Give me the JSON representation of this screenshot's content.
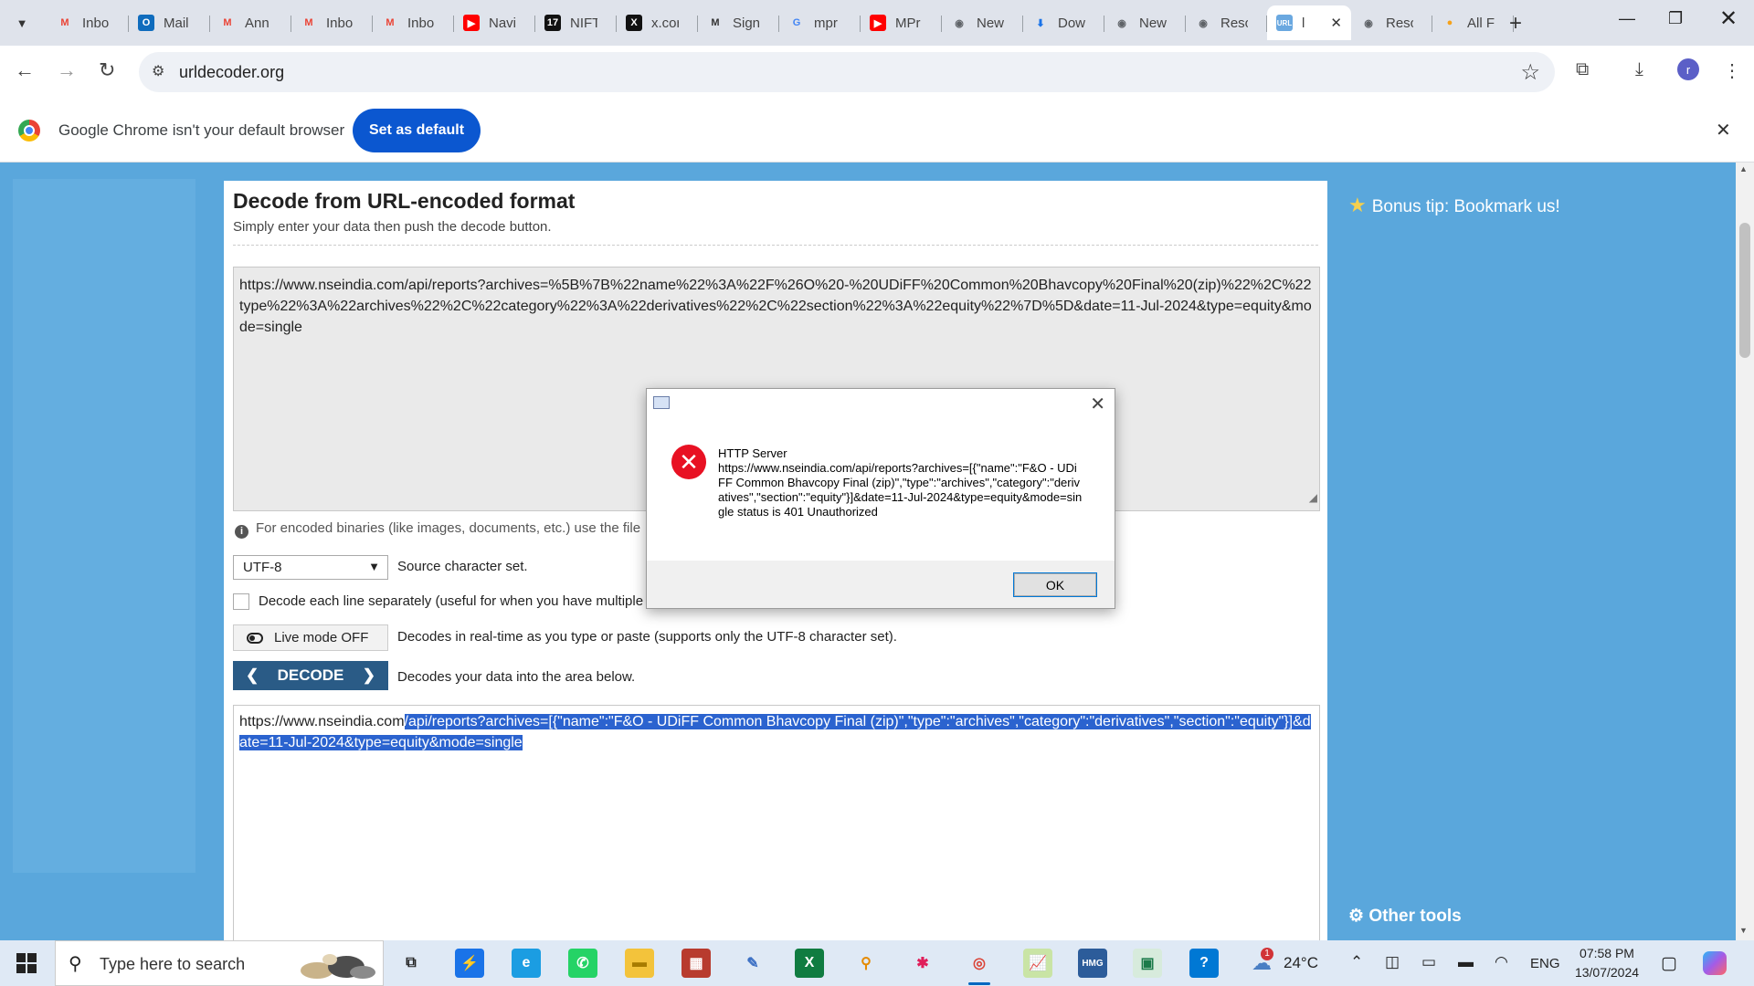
{
  "tabs": [
    {
      "label": "Inbo",
      "icon": "gmail-icon",
      "color": "#ea4335",
      "glyph": "M",
      "fg": "#ea4335",
      "bg": "transparent"
    },
    {
      "label": "Mail",
      "icon": "outlook-icon",
      "color": "#0f6cbd",
      "glyph": "O",
      "fg": "#ffffff",
      "bg": "#0f6cbd"
    },
    {
      "label": "Ann",
      "icon": "gmail-icon",
      "color": "#ea4335",
      "glyph": "M",
      "fg": "#ea4335",
      "bg": "transparent"
    },
    {
      "label": "Inbo",
      "icon": "gmail-icon",
      "color": "#ea4335",
      "glyph": "M",
      "fg": "#ea4335",
      "bg": "transparent"
    },
    {
      "label": "Inbo",
      "icon": "gmail-icon",
      "color": "#ea4335",
      "glyph": "M",
      "fg": "#ea4335",
      "bg": "transparent"
    },
    {
      "label": "Navi",
      "icon": "youtube-icon",
      "color": "#ff0000",
      "glyph": "▶",
      "fg": "#ffffff",
      "bg": "#ff0000"
    },
    {
      "label": "NIFT",
      "icon": "tradingview-icon",
      "color": "#000000",
      "glyph": "17",
      "fg": "#ffffff",
      "bg": "#111111"
    },
    {
      "label": "x.cor",
      "icon": "x-icon",
      "color": "#000000",
      "glyph": "X",
      "fg": "#ffffff",
      "bg": "#111111"
    },
    {
      "label": "Sign",
      "icon": "gmail-icon",
      "color": "#444444",
      "glyph": "M",
      "fg": "#333333",
      "bg": "transparent"
    },
    {
      "label": "mpr",
      "icon": "google-icon",
      "color": "#4285f4",
      "glyph": "G",
      "fg": "#4285f4",
      "bg": "transparent"
    },
    {
      "label": "MPr",
      "icon": "youtube-icon",
      "color": "#ff0000",
      "glyph": "▶",
      "fg": "#ffffff",
      "bg": "#ff0000"
    },
    {
      "label": "New",
      "icon": "globe-icon",
      "color": "#5f6368",
      "glyph": "◉",
      "fg": "#5f6368",
      "bg": "transparent"
    },
    {
      "label": "Dow",
      "icon": "download-icon",
      "color": "#1a73e8",
      "glyph": "⬇",
      "fg": "#1a73e8",
      "bg": "transparent"
    },
    {
      "label": "New",
      "icon": "globe-icon",
      "color": "#5f6368",
      "glyph": "◉",
      "fg": "#5f6368",
      "bg": "transparent"
    },
    {
      "label": "Reso",
      "icon": "globe-icon",
      "color": "#5f6368",
      "glyph": "◉",
      "fg": "#5f6368",
      "bg": "transparent"
    },
    {
      "label": "l",
      "icon": "urldecoder-icon",
      "color": "#4a90d9",
      "glyph": "URL",
      "fg": "#ffffff",
      "bg": "#6aa8e0",
      "active": true
    },
    {
      "label": "Reso",
      "icon": "globe-icon",
      "color": "#5f6368",
      "glyph": "◉",
      "fg": "#5f6368",
      "bg": "transparent"
    },
    {
      "label": "All F",
      "icon": "allfiles-icon",
      "color": "#e8453c",
      "glyph": "●",
      "fg": "#f6a21a",
      "bg": "transparent"
    }
  ],
  "toolbar": {
    "url": "urldecoder.org"
  },
  "infobar": {
    "message": "Google Chrome isn't your default browser",
    "button": "Set as default"
  },
  "page": {
    "title": "Decode from URL-encoded format",
    "subtitle": "Simply enter your data then push the decode button.",
    "input_value": "https://www.nseindia.com/api/reports?archives=%5B%7B%22name%22%3A%22F%26O%20-%20UDiFF%20Common%20Bhavcopy%20Final%20(zip)%22%2C%22type%22%3A%22archives%22%2C%22category%22%3A%22derivatives%22%2C%22section%22%3A%22equity%22%7D%5D&date=11-Jul-2024&type=equity&mode=single",
    "binaries_note": "For encoded binaries (like images, documents, etc.) use the file",
    "charset": "UTF-8",
    "charset_label": "Source character set.",
    "line_label": "Decode each line separately (useful for when you have multiple",
    "live_button": "Live mode OFF",
    "live_label": "Decodes in real-time as you type or paste (supports only the UTF-8 character set).",
    "decode_button": "DECODE",
    "decode_label": "Decodes your data into the area below.",
    "output_plain": "https://www.nseindia.com",
    "output_selected": "/api/reports?archives=[{\"name\":\"F&O - UDiFF Common Bhavcopy Final (zip)\",\"type\":\"archives\",\"category\":\"derivatives\",\"section\":\"equity\"}]&date=11-Jul-2024&type=equity&mode=single",
    "bonus_tip": "Bonus tip: Bookmark us!",
    "other_tools": "Other tools"
  },
  "dialog": {
    "title": "HTTP Server",
    "message": "https://www.nseindia.com/api/reports?archives=[{\"name\":\"F&O - UDiFF Common Bhavcopy Final (zip)\",\"type\":\"archives\",\"category\":\"derivatives\",\"section\":\"equity\"}]&date=11-Jul-2024&type=equity&mode=single status is 401 Unauthorized",
    "ok": "OK"
  },
  "taskbar": {
    "search_placeholder": "Type here to search",
    "apps": [
      {
        "icon": "task-view-icon",
        "glyph": "⧉",
        "bg": "transparent",
        "fg": "#222222"
      },
      {
        "icon": "power-automate-icon",
        "glyph": "⚡",
        "bg": "#1a73e8",
        "fg": "#ffffff"
      },
      {
        "icon": "edge-icon",
        "glyph": "e",
        "bg": "#1b9de2",
        "fg": "#ffffff"
      },
      {
        "icon": "whatsapp-icon",
        "glyph": "✆",
        "bg": "#25d366",
        "fg": "#ffffff"
      },
      {
        "icon": "file-explorer-icon",
        "glyph": "▬",
        "bg": "#f3c33b",
        "fg": "#a77b00"
      },
      {
        "icon": "app-grid-icon",
        "glyph": "▦",
        "bg": "#b83b2e",
        "fg": "#ffffff"
      },
      {
        "icon": "pen-app-icon",
        "glyph": "✎",
        "bg": "transparent",
        "fg": "#3b6fc4"
      },
      {
        "icon": "excel-icon",
        "glyph": "X",
        "bg": "#107c41",
        "fg": "#ffffff"
      },
      {
        "icon": "search-app-icon",
        "glyph": "⚲",
        "bg": "transparent",
        "fg": "#e58a00"
      },
      {
        "icon": "slack-icon",
        "glyph": "✱",
        "bg": "transparent",
        "fg": "#e01e5a"
      },
      {
        "icon": "chrome-icon",
        "glyph": "◎",
        "bg": "transparent",
        "fg": "#db4437",
        "active": true
      },
      {
        "icon": "chart-app-icon",
        "glyph": "📈",
        "bg": "#c9e4a5",
        "fg": "#2a6b2a"
      },
      {
        "icon": "hmg-icon",
        "glyph": "HMG",
        "bg": "#2c5c9a",
        "fg": "#ffffff"
      },
      {
        "icon": "window-app-icon",
        "glyph": "▣",
        "bg": "#d7ebdc",
        "fg": "#1c7a4a"
      },
      {
        "icon": "help-icon",
        "glyph": "?",
        "bg": "#0078d4",
        "fg": "#ffffff"
      }
    ],
    "weather_badge": "1",
    "temperature": "24°C",
    "language": "ENG",
    "time": "07:58 PM",
    "date": "13/07/2024"
  }
}
